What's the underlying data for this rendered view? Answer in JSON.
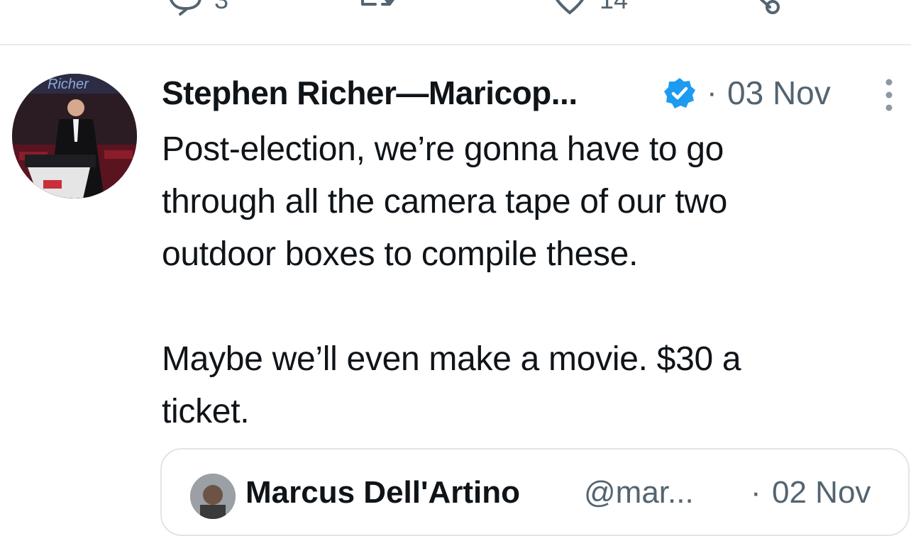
{
  "previous_tweet": {
    "reply_count": "3",
    "like_count": "14"
  },
  "tweet": {
    "author_name": "Stephen Richer—Maricop...",
    "verified": true,
    "separator": "·",
    "date": "03 Nov",
    "avatar_banner_text": "Richer",
    "text": "Post-election, we’re gonna have to go\nthrough all the camera tape of our two\noutdoor boxes to compile these.\n\nMaybe we’ll even make a movie. $30 a\nticket."
  },
  "quoted_tweet": {
    "author_name": "Marcus Dell'Artino",
    "handle": "@mar...",
    "separator": "·",
    "date": "02 Nov"
  },
  "icons": [
    "reply-icon",
    "retweet-icon",
    "like-icon",
    "share-icon",
    "verified-badge-icon",
    "more-options-icon"
  ],
  "colors": {
    "verified": "#1d9bf0",
    "secondary_text": "#536471",
    "divider": "#e6ecf0"
  }
}
